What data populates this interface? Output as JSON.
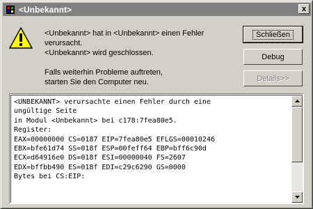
{
  "window": {
    "title": "<Unbekannt>"
  },
  "titlebar": {
    "close_label": "x"
  },
  "message": {
    "lines": [
      "<Unbekannt> hat in <Unbekannt> einen Fehler",
      "verursacht.",
      "<Unbekannt> wird geschlossen."
    ],
    "hint_lines": [
      "Falls weiterhin Probleme auftreten,",
      "starten Sie den Computer neu."
    ]
  },
  "buttons": {
    "close": "Schließen",
    "debug": "Debug",
    "details": "Details>>"
  },
  "details": {
    "lines": [
      "<UNBEKANNT> verursachte einen Fehler durch eine",
      "ungültige Seite",
      "in Modul <Unbekannt> bei c178:7fea80e5.",
      "Register:",
      "EAX=00000000 CS=0187 EIP=7fea80e5 EFLGS=00010246",
      "EBX=bfe61d74 SS=018f ESP=00feff64 EBP=bff6c90d",
      "ECX=d64916e0 DS=018f ESI=00000040 FS=2607",
      "EDX=bffbb490 ES=018f EDI=c29c6290 GS=0000",
      "Bytes bei CS:EIP:"
    ]
  },
  "icons": {
    "app": "app-icon",
    "warning": "warning-icon",
    "scroll_up": "arrow-up-icon",
    "scroll_down": "arrow-down-icon"
  },
  "colors": {
    "titlebar_inactive": "#808080",
    "face": "#d4d0c8",
    "warning_yellow": "#ffff00"
  }
}
